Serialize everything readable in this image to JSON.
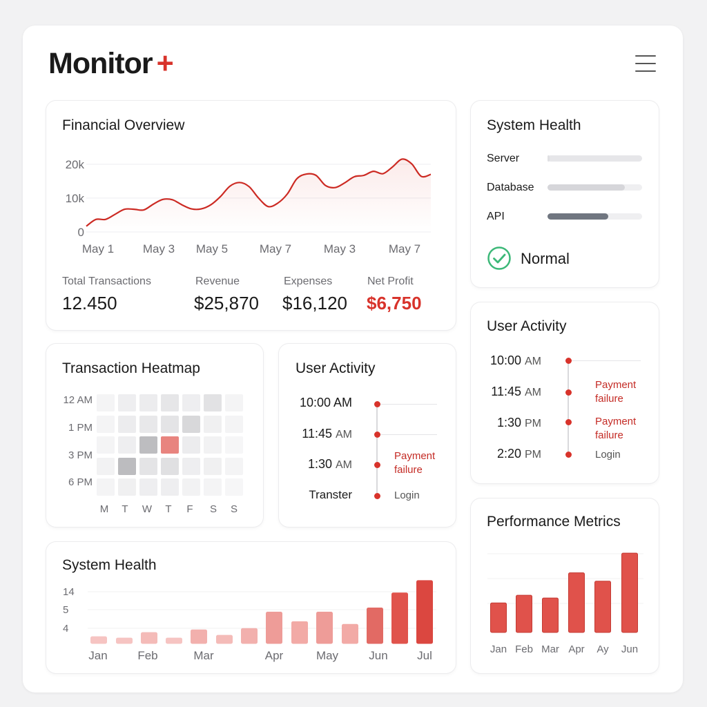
{
  "app": {
    "name": "Monitor",
    "name_suffix": "+"
  },
  "colors": {
    "accent": "#d8332b",
    "accent_light": "#f2a3a0",
    "muted": "#6b6b70",
    "ok": "#3cb878"
  },
  "financial": {
    "title": "Financial Overview",
    "stats": [
      {
        "label": "Total Transactions",
        "value": "12.450"
      },
      {
        "label": "Revenue",
        "value": "$25,870"
      },
      {
        "label": "Expenses",
        "value": "$16,120"
      },
      {
        "label": "Net Profit",
        "value": "$6,750"
      }
    ]
  },
  "system_health_status": {
    "title": "System Health",
    "rows": [
      {
        "label": "Server",
        "level": 0.02
      },
      {
        "label": "Database",
        "level": 0.82
      },
      {
        "label": "API",
        "level": 0.64
      }
    ],
    "status": "Normal",
    "status_icon": "check-circle-icon"
  },
  "heatmap": {
    "title": "Transaction Heatmap",
    "row_labels": [
      "12 AM",
      "1 PM",
      "3 PM",
      "6 PM"
    ],
    "col_labels": [
      "M",
      "T",
      "W",
      "T",
      "F",
      "S",
      "S"
    ]
  },
  "activity_mid": {
    "title": "User Activity",
    "entries": [
      {
        "time": "10:00",
        "ampm": "AM",
        "event": ""
      },
      {
        "time": "11:45",
        "ampm": "AM",
        "event": ""
      },
      {
        "time": "1:30",
        "ampm": "AM",
        "event": "Payment failure"
      },
      {
        "time": "Transter",
        "ampm": "",
        "event": "Login"
      }
    ]
  },
  "activity_right": {
    "title": "User Activity",
    "entries": [
      {
        "time": "10:00",
        "ampm": "AM",
        "event": ""
      },
      {
        "time": "11:45",
        "ampm": "AM",
        "event": "Payment failure"
      },
      {
        "time": "1:30",
        "ampm": "PM",
        "event": "Payment failure"
      },
      {
        "time": "2:20",
        "ampm": "PM",
        "event": "Login"
      }
    ]
  },
  "chart_data": [
    {
      "id": "financial",
      "type": "area",
      "x_tick_labels": [
        "May 1",
        "May 3",
        "May 5",
        "May 7",
        "May 3",
        "May 7"
      ],
      "y_tick_labels": [
        "0",
        "10k",
        "20k"
      ],
      "ylim": [
        0,
        22000
      ],
      "x": [
        0,
        0.5,
        1,
        1.5,
        2,
        2.5,
        3,
        3.5,
        4,
        4.5,
        5,
        5.5,
        6,
        6.5,
        7,
        7.5,
        8,
        8.5,
        9,
        9.5,
        10,
        10.5,
        11,
        11.5,
        12,
        12.5,
        13,
        13.5,
        14,
        14.5,
        15,
        15.5,
        16,
        16.5,
        17,
        17.5,
        18
      ],
      "y": [
        1500,
        3500,
        3500,
        5000,
        6500,
        6500,
        6300,
        8000,
        9400,
        9300,
        7800,
        6600,
        6600,
        7800,
        10200,
        13300,
        14400,
        13200,
        9800,
        7300,
        8300,
        11000,
        15500,
        16900,
        16500,
        13500,
        12900,
        14300,
        16100,
        16500,
        17700,
        17000,
        19000,
        21300,
        19900,
        16200,
        16800
      ]
    },
    {
      "id": "system-health-bars",
      "type": "bar",
      "categories": [
        "Jan",
        "",
        "Feb",
        "",
        "Mar",
        "",
        "",
        "Apr",
        "",
        "May",
        "",
        "Jun",
        "",
        "Jul"
      ],
      "x_tick_labels": [
        "Jan",
        "Feb",
        "Mar",
        "Apr",
        "May",
        "Jun",
        "Jul"
      ],
      "y_tick_labels": [
        "4",
        "5",
        "14"
      ],
      "values": [
        0.5,
        0.4,
        0.8,
        0.4,
        1.0,
        0.6,
        1.1,
        2.3,
        1.6,
        2.3,
        1.4,
        2.6,
        3.7,
        4.6
      ],
      "ylim": [
        0,
        5
      ]
    },
    {
      "id": "performance",
      "type": "bar",
      "categories": [
        "Jan",
        "Feb",
        "Mar",
        "Apr",
        "Ay",
        "Jun"
      ],
      "values": [
        42,
        53,
        49,
        85,
        73,
        113
      ],
      "ylim": [
        0,
        120
      ]
    }
  ],
  "sections": {
    "system_health_bars_title": "System Health",
    "performance_title": "Performance Metrics"
  }
}
